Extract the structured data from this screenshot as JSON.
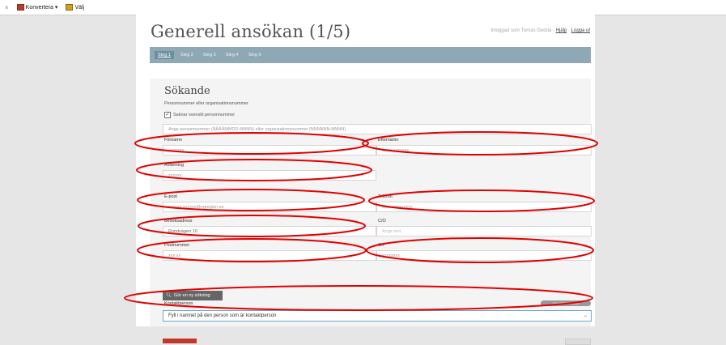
{
  "toolbar": {
    "close": "×",
    "convert_label": "Konvertera",
    "convert_arrow": "▾",
    "select_label": "Välj"
  },
  "header": {
    "title": "Generell ansökan (1/5)",
    "logged_in": "Inloggad som Tomas Gedda",
    "separator": "·",
    "help": "Hjälp",
    "logout": "Logga ut"
  },
  "steps": [
    "Steg 1",
    "Steg 2",
    "Steg 3",
    "Steg 4",
    "Steg 5"
  ],
  "form": {
    "section_title": "Sökande",
    "hint": "Personnummer eller organisationsnummer",
    "missing_pnr_label": "Saknar svenskt personnummer",
    "missing_pnr_checked": true,
    "id_placeholder": "Ange personnummer (ÅÅÅÅMMDD-NNNN) eller organisationsnummer (NNNNNN-NNNN)",
    "fornamn_label": "Förnamn",
    "fornamn_value": "xxxxxxx",
    "efternamn_label": "Efternamn",
    "efternamn_value": "xxxxxxxxxxxx",
    "avdelning_label": "Avdelning",
    "avdelning_value": "xxxxxx",
    "epost_label": "E-post",
    "epost_value": "xxxxxx.xxxxxx@vgregion.se",
    "telefon_label": "Telefon",
    "telefon_value": "xxxx-xxxxxxxxx",
    "besok_label": "Besöksadress",
    "besok_value": "Rondvägen 10",
    "co_label": "C/O",
    "co_placeholder": "Ange text",
    "post_label": "Postnummer",
    "post_value": "xxx xx",
    "ort_label": "Ort",
    "ort_value": "xxxxxxxx",
    "search_button": "Gör en ny sökning",
    "kontakt_label": "Kontaktperson",
    "kontakt_badge": "xxx xxxxxxxxxxx",
    "kontakt_value": "Fyll i namnet på den person som är kontaktperson"
  },
  "colors": {
    "stepbar": "#8ea8b5",
    "annotation": "#e00000"
  }
}
